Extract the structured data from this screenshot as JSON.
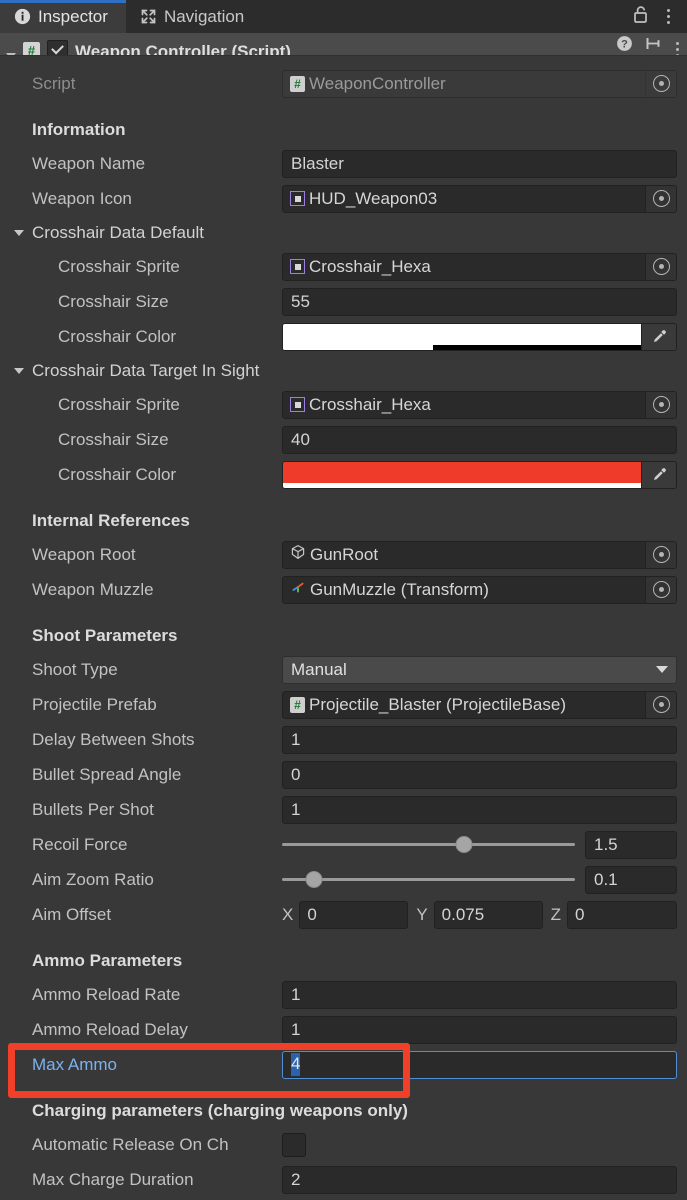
{
  "window": {
    "tabs": [
      {
        "label": "Inspector",
        "icon": "info-icon",
        "active": true
      },
      {
        "label": "Navigation",
        "icon": "navigation-icon",
        "active": false
      }
    ],
    "lock_icon": "unlocked-padlock-icon",
    "menu_icon": "kebab-menu-icon"
  },
  "component": {
    "title": "Weapon Controller (Script)",
    "script_badge": "#",
    "enabled": true,
    "help_icon": "help-icon",
    "preset_icon": "preset-icon",
    "menu_icon": "kebab-menu-icon"
  },
  "script_row": {
    "label": "Script",
    "value": "WeaponController",
    "icon": "cs-script-icon",
    "selector_icon": "object-picker-icon"
  },
  "sections": {
    "information": {
      "header": "Information",
      "weapon_name": {
        "label": "Weapon Name",
        "value": "Blaster"
      },
      "weapon_icon": {
        "label": "Weapon Icon",
        "value": "HUD_Weapon03",
        "icon": "sprite-icon",
        "selector_icon": "object-picker-icon"
      }
    },
    "crosshair_default": {
      "foldout_label": "Crosshair Data Default",
      "expanded": true,
      "sprite": {
        "label": "Crosshair Sprite",
        "value": "Crosshair_Hexa",
        "icon": "sprite-icon",
        "selector_icon": "object-picker-icon"
      },
      "size": {
        "label": "Crosshair Size",
        "value": "55"
      },
      "color": {
        "label": "Crosshair Color",
        "swatch_hex": "#ffffff",
        "alpha_hex": "#000000",
        "alpha_fill_pct": 58,
        "eyedropper_icon": "eyedropper-icon"
      }
    },
    "crosshair_target": {
      "foldout_label": "Crosshair Data Target In Sight",
      "expanded": true,
      "sprite": {
        "label": "Crosshair Sprite",
        "value": "Crosshair_Hexa",
        "icon": "sprite-icon",
        "selector_icon": "object-picker-icon"
      },
      "size": {
        "label": "Crosshair Size",
        "value": "40"
      },
      "color": {
        "label": "Crosshair Color",
        "swatch_hex": "#ee3b2a",
        "alpha_hex": "#ffffff",
        "alpha_fill_pct": 0,
        "eyedropper_icon": "eyedropper-icon"
      }
    },
    "internal_references": {
      "header": "Internal References",
      "weapon_root": {
        "label": "Weapon Root",
        "value": "GunRoot",
        "icon": "gameobject-cube-icon",
        "selector_icon": "object-picker-icon"
      },
      "weapon_muzzle": {
        "label": "Weapon Muzzle",
        "value": "GunMuzzle (Transform)",
        "icon": "transform-axis-icon",
        "selector_icon": "object-picker-icon"
      }
    },
    "shoot_parameters": {
      "header": "Shoot Parameters",
      "shoot_type": {
        "label": "Shoot Type",
        "value": "Manual",
        "caret_icon": "chevron-down-icon"
      },
      "projectile_prefab": {
        "label": "Projectile Prefab",
        "value": "Projectile_Blaster (ProjectileBase)",
        "icon": "cs-script-icon",
        "selector_icon": "object-picker-icon"
      },
      "delay_between_shots": {
        "label": "Delay Between Shots",
        "value": "1"
      },
      "bullet_spread_angle": {
        "label": "Bullet Spread Angle",
        "value": "0"
      },
      "bullets_per_shot": {
        "label": "Bullets Per Shot",
        "value": "1"
      },
      "recoil_force": {
        "label": "Recoil Force",
        "value": "1.5",
        "slider_pct": 62
      },
      "aim_zoom_ratio": {
        "label": "Aim Zoom Ratio",
        "value": "0.1",
        "slider_pct": 11
      },
      "aim_offset": {
        "label": "Aim Offset",
        "x_label": "X",
        "x_value": "0",
        "y_label": "Y",
        "y_value": "0.075",
        "z_label": "Z",
        "z_value": "0"
      }
    },
    "ammo_parameters": {
      "header": "Ammo Parameters",
      "ammo_reload_rate": {
        "label": "Ammo Reload Rate",
        "value": "1"
      },
      "ammo_reload_delay": {
        "label": "Ammo Reload Delay",
        "value": "1"
      },
      "max_ammo": {
        "label": "Max Ammo",
        "value": "4",
        "focused": true,
        "selected": true
      }
    },
    "charging_parameters": {
      "header": "Charging parameters (charging weapons only)",
      "automatic_release": {
        "label": "Automatic Release On Ch",
        "checked": false
      },
      "max_charge_duration": {
        "label": "Max Charge Duration",
        "value": "2"
      }
    }
  },
  "annotation": {
    "color": "#f0402a",
    "targets": "max-ammo-row"
  }
}
